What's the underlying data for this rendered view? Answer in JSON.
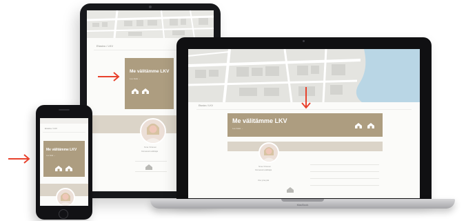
{
  "page": {
    "card_title": "Me välitämme LKV",
    "card_subtitle": "Lue lisää →",
    "breadcrumb": "Etusivu / LKV",
    "agent_name": "Nina Virtanen",
    "agent_role": "Kiinteistönvälittäjä",
    "agent_link": "Ota yhteyttä",
    "laptop_brand": "MacBook"
  },
  "annotations": {
    "arrow_color": "#e8412c"
  },
  "colors": {
    "card": "#ad9d80",
    "band": "#dbd4c8",
    "device": "#121215"
  }
}
